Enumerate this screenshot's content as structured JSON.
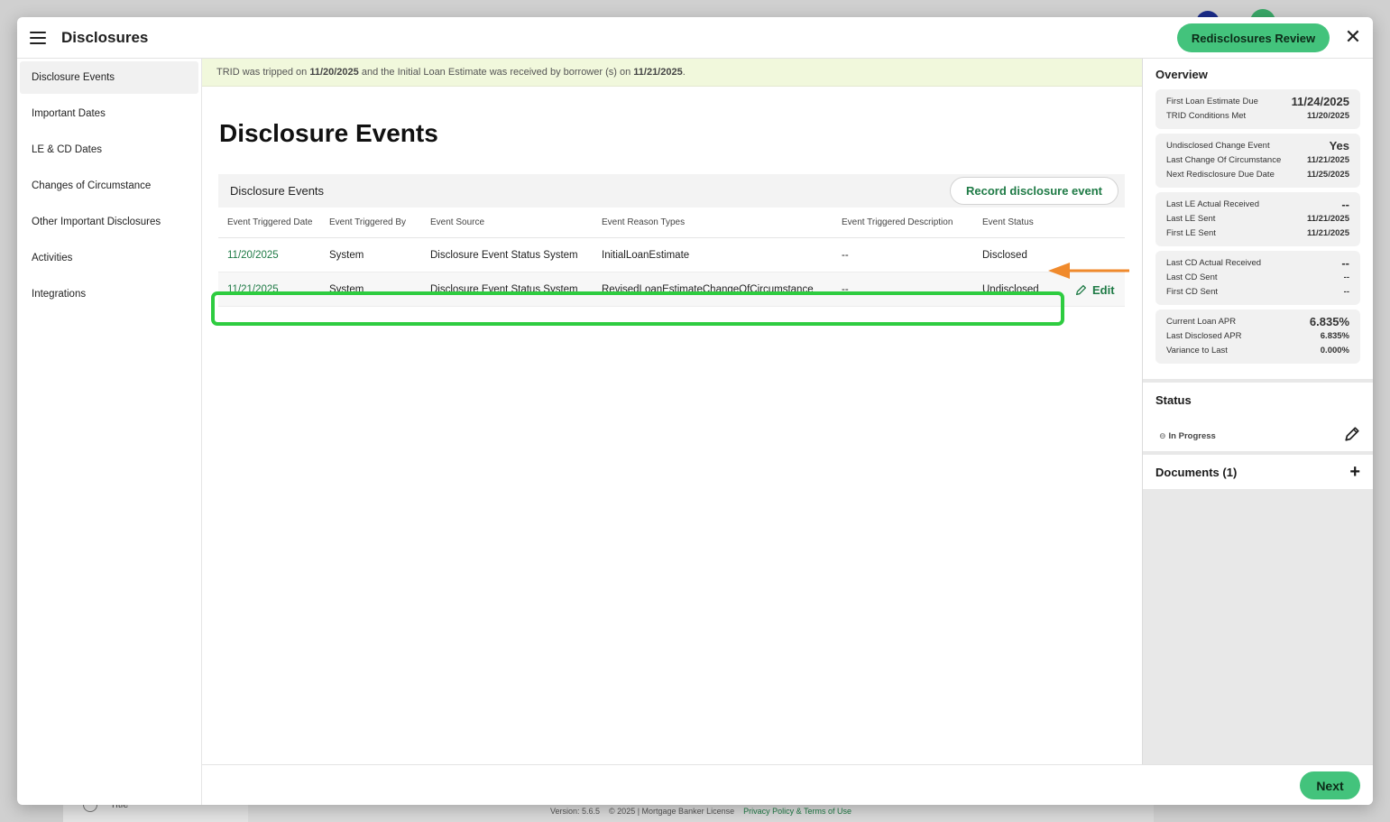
{
  "background": {
    "footer_version": "Version: 5.6.5",
    "footer_copyright": "© 2025 | Mortgage Banker License",
    "footer_privacy": "Privacy Policy & Terms of Use",
    "left_item_label": "Title"
  },
  "header": {
    "title": "Disclosures",
    "redisclosures_button": "Redisclosures Review",
    "close_icon": "close-icon"
  },
  "sidebar": {
    "items": [
      {
        "label": "Disclosure Events"
      },
      {
        "label": "Important Dates"
      },
      {
        "label": "LE & CD Dates"
      },
      {
        "label": "Changes of Circumstance"
      },
      {
        "label": "Other Important Disclosures"
      },
      {
        "label": "Activities"
      },
      {
        "label": "Integrations"
      }
    ]
  },
  "banner": {
    "prefix": "TRID was tripped on ",
    "date1": "11/20/2025",
    "middle": " and the Initial Loan Estimate was received by borrower (s) on ",
    "date2": "11/21/2025",
    "suffix": "."
  },
  "main": {
    "page_title": "Disclosure Events",
    "card_title": "Disclosure Events",
    "record_button": "Record disclosure event",
    "columns": [
      "Event Triggered Date",
      "Event Triggered By",
      "Event Source",
      "Event Reason Types",
      "Event Triggered Description",
      "Event Status"
    ],
    "rows": [
      [
        "11/20/2025",
        "System",
        "Disclosure Event Status System",
        "InitialLoanEstimate",
        "--",
        "Disclosed"
      ],
      [
        "11/21/2025",
        "System",
        "Disclosure Event Status System",
        "RevisedLoanEstimateChangeOfCircumstance",
        "--",
        "Undisclosed"
      ]
    ],
    "edit_label": "Edit"
  },
  "overview": {
    "title": "Overview",
    "cards": [
      [
        {
          "label": "First Loan Estimate Due",
          "value": "11/24/2025"
        },
        {
          "label": "TRID Conditions Met",
          "value": "11/20/2025"
        }
      ],
      [
        {
          "label": "Undisclosed Change Event",
          "value": "Yes"
        },
        {
          "label": "Last Change Of Circumstance",
          "value": "11/21/2025"
        },
        {
          "label": "Next Redisclosure Due Date",
          "value": "11/25/2025"
        }
      ],
      [
        {
          "label": "Last LE Actual Received",
          "value": "--"
        },
        {
          "label": "Last LE Sent",
          "value": "11/21/2025"
        },
        {
          "label": "First LE Sent",
          "value": "11/21/2025"
        }
      ],
      [
        {
          "label": "Last CD Actual Received",
          "value": "--"
        },
        {
          "label": "Last CD Sent",
          "value": "--"
        },
        {
          "label": "First CD Sent",
          "value": "--"
        }
      ],
      [
        {
          "label": "Current Loan APR",
          "value": "6.835%"
        },
        {
          "label": "Last Disclosed APR",
          "value": "6.835%"
        },
        {
          "label": "Variance to Last",
          "value": "0.000%"
        }
      ]
    ]
  },
  "status": {
    "title": "Status",
    "value": "In Progress"
  },
  "documents": {
    "title": "Documents (1)"
  },
  "footer": {
    "next_button": "Next"
  },
  "colors": {
    "accent": "#43c37c",
    "link": "#1e7a45",
    "highlight_box": "#2ecc40",
    "arrow": "#f08a2c",
    "banner_bg": "#f1f8dc"
  }
}
